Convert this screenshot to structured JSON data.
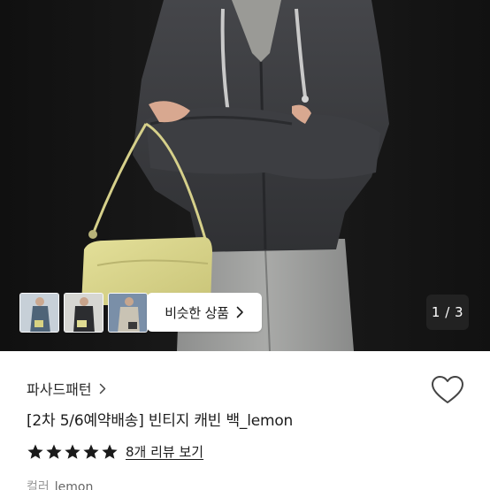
{
  "hero": {
    "pager": "1 / 3",
    "similar_label": "비슷한 상품"
  },
  "shop": {
    "name": "파사드패턴"
  },
  "product": {
    "title": "[2차 5/6예약배송] 빈티지 캐빈 백_lemon",
    "rating_stars": 5,
    "review_link": "8개 리뷰 보기",
    "color_label": "컬러",
    "color_value": "lemon"
  },
  "colors": {
    "star": "#1a1a1a",
    "bag": "#ddd98a",
    "jacket": "#3a3b3d"
  }
}
